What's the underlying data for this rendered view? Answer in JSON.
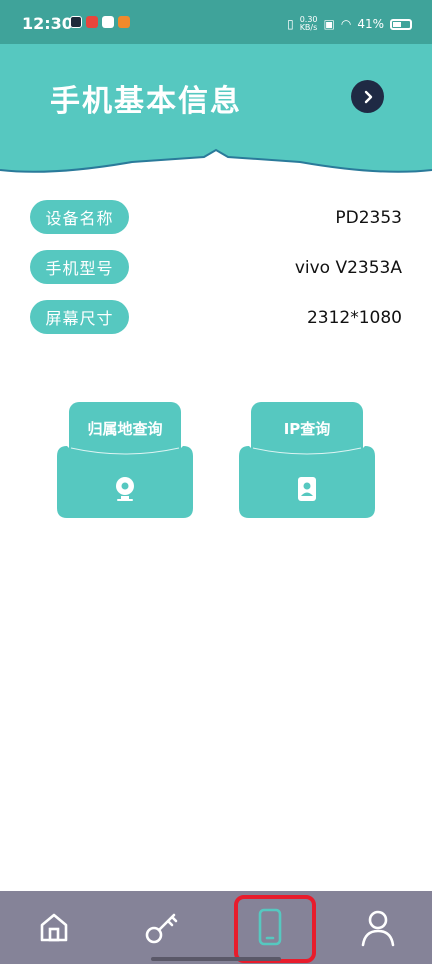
{
  "status_bar": {
    "time": "12:30",
    "net_speed": "0.30\nKB/s",
    "battery": "41%"
  },
  "header": {
    "title": "手机基本信息",
    "next_icon": "chevron-right-icon"
  },
  "info": [
    {
      "label": "设备名称",
      "value": "PD2353"
    },
    {
      "label": "手机型号",
      "value": "vivo V2353A"
    },
    {
      "label": "屏幕尺寸",
      "value": "2312*1080"
    }
  ],
  "actions": [
    {
      "label": "归属地查询",
      "icon": "location-pin-icon"
    },
    {
      "label": "IP查询",
      "icon": "id-card-icon"
    }
  ],
  "nav": {
    "items": [
      {
        "icon": "home-icon"
      },
      {
        "icon": "key-icon"
      },
      {
        "icon": "phone-icon",
        "selected": true
      },
      {
        "icon": "user-icon"
      }
    ]
  },
  "colors": {
    "teal": "#56c8c0",
    "teal_dark": "#3fa39a",
    "nav_bg": "#858398",
    "selected_outline": "#e81c2c"
  }
}
